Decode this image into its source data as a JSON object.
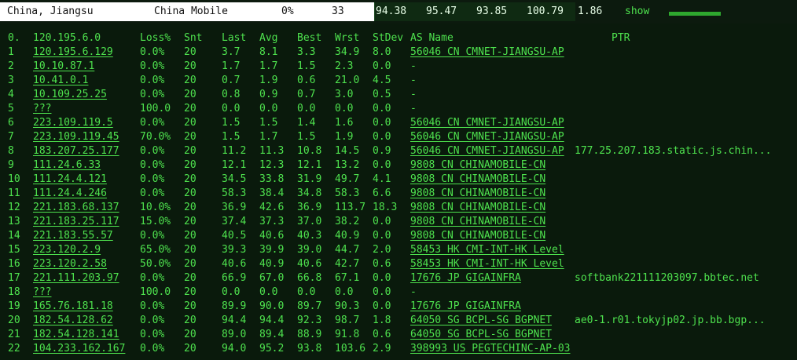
{
  "header": {
    "location": "China, Jiangsu",
    "isp": "China Mobile",
    "loss": "0%",
    "sent": "33",
    "last": "94.38",
    "avg": "95.47",
    "best": "93.85",
    "worst": "100.79",
    "stdev": "1.86",
    "show_label": "show"
  },
  "columns": [
    "Loss%",
    "Snt",
    "Last",
    "Avg",
    "Best",
    "Wrst",
    "StDev",
    "AS Name",
    "PTR"
  ],
  "destination": {
    "idx": "0.",
    "host": "120.195.6.0"
  },
  "hops": [
    {
      "idx": "1",
      "host": "120.195.6.129",
      "loss": "0.0%",
      "snt": "20",
      "last": "3.7",
      "avg": "8.1",
      "best": "3.3",
      "wrst": "34.9",
      "stdev": "8.0",
      "as": "56046 CN CMNET-JIANGSU-AP",
      "ptr": ""
    },
    {
      "idx": "2",
      "host": "10.10.87.1",
      "loss": "0.0%",
      "snt": "20",
      "last": "1.7",
      "avg": "1.7",
      "best": "1.5",
      "wrst": "2.3",
      "stdev": "0.0",
      "as": "-",
      "ptr": ""
    },
    {
      "idx": "3",
      "host": "10.41.0.1",
      "loss": "0.0%",
      "snt": "20",
      "last": "0.7",
      "avg": "1.9",
      "best": "0.6",
      "wrst": "21.0",
      "stdev": "4.5",
      "as": "-",
      "ptr": ""
    },
    {
      "idx": "4",
      "host": "10.109.25.25",
      "loss": "0.0%",
      "snt": "20",
      "last": "0.8",
      "avg": "0.9",
      "best": "0.7",
      "wrst": "3.0",
      "stdev": "0.5",
      "as": "-",
      "ptr": ""
    },
    {
      "idx": "5",
      "host": "???",
      "loss": "100.0",
      "snt": "20",
      "last": "0.0",
      "avg": "0.0",
      "best": "0.0",
      "wrst": "0.0",
      "stdev": "0.0",
      "as": "-",
      "ptr": ""
    },
    {
      "idx": "6",
      "host": "223.109.119.5",
      "loss": "0.0%",
      "snt": "20",
      "last": "1.5",
      "avg": "1.5",
      "best": "1.4",
      "wrst": "1.6",
      "stdev": "0.0",
      "as": "56046 CN CMNET-JIANGSU-AP",
      "ptr": ""
    },
    {
      "idx": "7",
      "host": "223.109.119.45",
      "loss": "70.0%",
      "snt": "20",
      "last": "1.5",
      "avg": "1.7",
      "best": "1.5",
      "wrst": "1.9",
      "stdev": "0.0",
      "as": "56046 CN CMNET-JIANGSU-AP",
      "ptr": ""
    },
    {
      "idx": "8",
      "host": "183.207.25.177",
      "loss": "0.0%",
      "snt": "20",
      "last": "11.2",
      "avg": "11.3",
      "best": "10.8",
      "wrst": "14.5",
      "stdev": "0.9",
      "as": "56046 CN CMNET-JIANGSU-AP",
      "ptr": "177.25.207.183.static.js.chin..."
    },
    {
      "idx": "9",
      "host": "111.24.6.33",
      "loss": "0.0%",
      "snt": "20",
      "last": "12.1",
      "avg": "12.3",
      "best": "12.1",
      "wrst": "13.2",
      "stdev": "0.0",
      "as": "9808 CN CHINAMOBILE-CN",
      "ptr": ""
    },
    {
      "idx": "10",
      "host": "111.24.4.121",
      "loss": "0.0%",
      "snt": "20",
      "last": "34.5",
      "avg": "33.8",
      "best": "31.9",
      "wrst": "49.7",
      "stdev": "4.1",
      "as": "9808 CN CHINAMOBILE-CN",
      "ptr": ""
    },
    {
      "idx": "11",
      "host": "111.24.4.246",
      "loss": "0.0%",
      "snt": "20",
      "last": "58.3",
      "avg": "38.4",
      "best": "34.8",
      "wrst": "58.3",
      "stdev": "6.6",
      "as": "9808 CN CHINAMOBILE-CN",
      "ptr": ""
    },
    {
      "idx": "12",
      "host": "221.183.68.137",
      "loss": "10.0%",
      "snt": "20",
      "last": "36.9",
      "avg": "42.6",
      "best": "36.9",
      "wrst": "113.7",
      "stdev": "18.3",
      "as": "9808 CN CHINAMOBILE-CN",
      "ptr": ""
    },
    {
      "idx": "13",
      "host": "221.183.25.117",
      "loss": "15.0%",
      "snt": "20",
      "last": "37.4",
      "avg": "37.3",
      "best": "37.0",
      "wrst": "38.2",
      "stdev": "0.0",
      "as": "9808 CN CHINAMOBILE-CN",
      "ptr": ""
    },
    {
      "idx": "14",
      "host": "221.183.55.57",
      "loss": "0.0%",
      "snt": "20",
      "last": "40.5",
      "avg": "40.6",
      "best": "40.3",
      "wrst": "40.9",
      "stdev": "0.0",
      "as": "9808 CN CHINAMOBILE-CN",
      "ptr": ""
    },
    {
      "idx": "15",
      "host": "223.120.2.9",
      "loss": "65.0%",
      "snt": "20",
      "last": "39.3",
      "avg": "39.9",
      "best": "39.0",
      "wrst": "44.7",
      "stdev": "2.0",
      "as": "58453 HK CMI-INT-HK Level",
      "ptr": ""
    },
    {
      "idx": "16",
      "host": "223.120.2.58",
      "loss": "50.0%",
      "snt": "20",
      "last": "40.6",
      "avg": "40.9",
      "best": "40.6",
      "wrst": "42.7",
      "stdev": "0.6",
      "as": "58453 HK CMI-INT-HK Level",
      "ptr": ""
    },
    {
      "idx": "17",
      "host": "221.111.203.97",
      "loss": "0.0%",
      "snt": "20",
      "last": "66.9",
      "avg": "67.0",
      "best": "66.8",
      "wrst": "67.1",
      "stdev": "0.0",
      "as": "17676 JP GIGAINFRA",
      "ptr": "softbank221111203097.bbtec.net"
    },
    {
      "idx": "18",
      "host": "???",
      "loss": "100.0",
      "snt": "20",
      "last": "0.0",
      "avg": "0.0",
      "best": "0.0",
      "wrst": "0.0",
      "stdev": "0.0",
      "as": "-",
      "ptr": ""
    },
    {
      "idx": "19",
      "host": "165.76.181.18",
      "loss": "0.0%",
      "snt": "20",
      "last": "89.9",
      "avg": "90.0",
      "best": "89.7",
      "wrst": "90.3",
      "stdev": "0.0",
      "as": "17676 JP GIGAINFRA",
      "ptr": ""
    },
    {
      "idx": "20",
      "host": "182.54.128.62",
      "loss": "0.0%",
      "snt": "20",
      "last": "94.4",
      "avg": "94.4",
      "best": "92.3",
      "wrst": "98.7",
      "stdev": "1.8",
      "as": "64050 SG BCPL-SG BGPNET",
      "ptr": "ae0-1.r01.tokyjp02.jp.bb.bgp..."
    },
    {
      "idx": "21",
      "host": "182.54.128.141",
      "loss": "0.0%",
      "snt": "20",
      "last": "89.0",
      "avg": "89.4",
      "best": "88.9",
      "wrst": "91.8",
      "stdev": "0.6",
      "as": "64050 SG BCPL-SG BGPNET",
      "ptr": ""
    },
    {
      "idx": "22",
      "host": "104.233.162.167",
      "loss": "0.0%",
      "snt": "20",
      "last": "94.0",
      "avg": "95.2",
      "best": "93.8",
      "wrst": "103.6",
      "stdev": "2.9",
      "as": "398993 US PEGTECHINC-AP-03",
      "ptr": ""
    }
  ]
}
